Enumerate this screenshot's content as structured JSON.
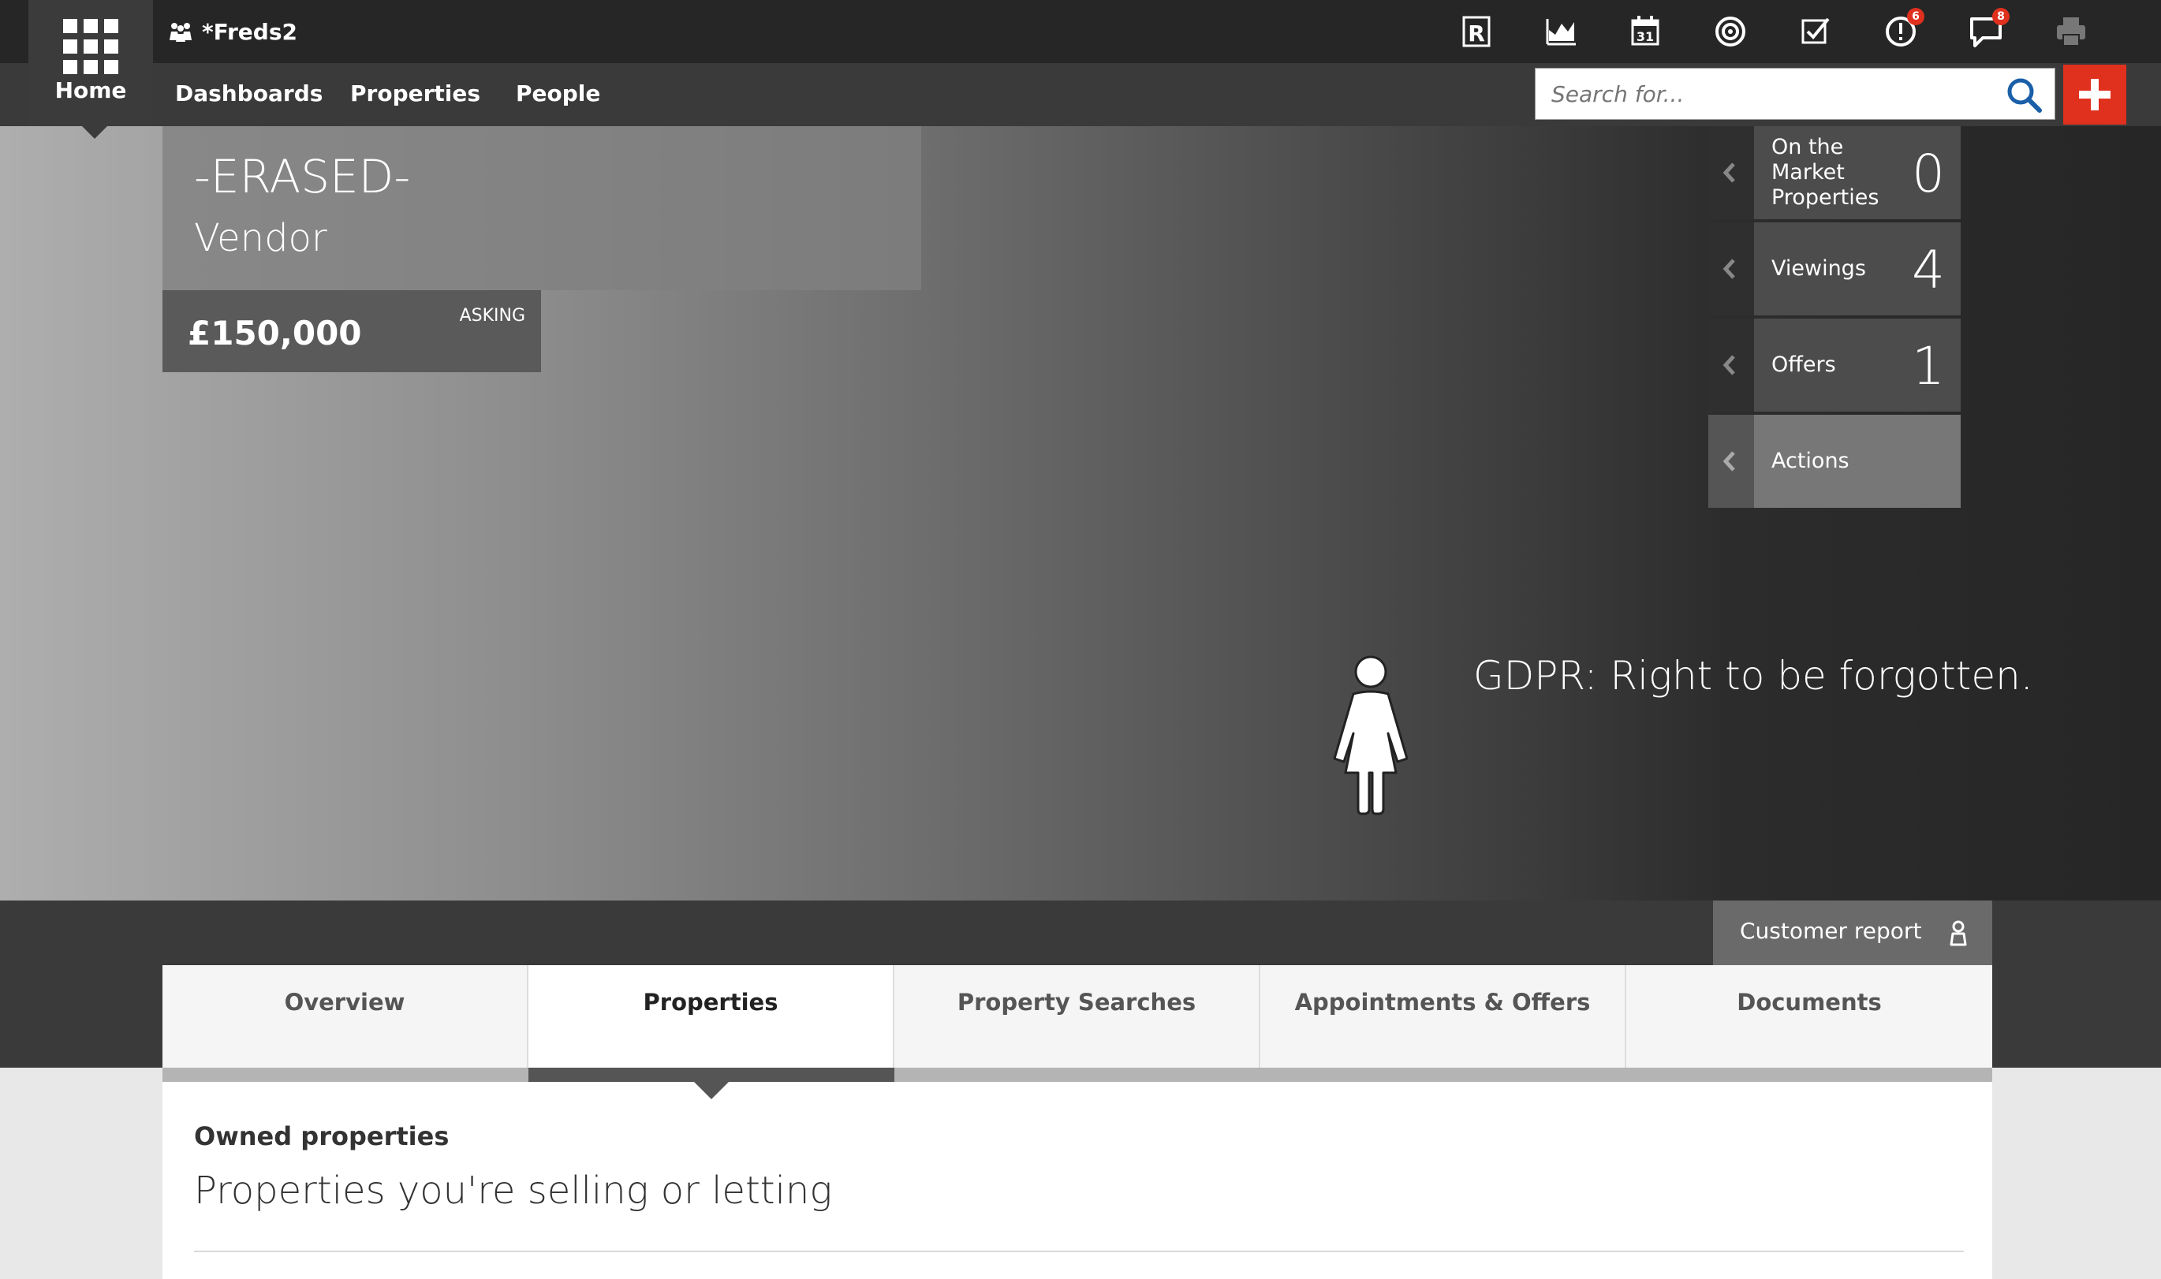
{
  "header": {
    "home_label": "Home",
    "brand_name": "*Freds2",
    "notifications": {
      "alerts_count": "6",
      "messages_count": "8"
    }
  },
  "nav": {
    "items": [
      {
        "label": "Dashboards"
      },
      {
        "label": "Properties"
      },
      {
        "label": "People"
      }
    ]
  },
  "search": {
    "placeholder": "Search for..."
  },
  "profile": {
    "name": "-ERASED-",
    "role": "Vendor",
    "price": "£150,000",
    "price_label": "ASKING"
  },
  "stats": [
    {
      "label": "On the Market Properties",
      "value": "0"
    },
    {
      "label": "Viewings",
      "value": "4"
    },
    {
      "label": "Offers",
      "value": "1"
    },
    {
      "label": "Actions",
      "value": ""
    }
  ],
  "gdpr": {
    "text": "GDPR: Right to be forgotten."
  },
  "customer_report": {
    "label": "Customer report"
  },
  "tabs": [
    {
      "label": "Overview"
    },
    {
      "label": "Properties"
    },
    {
      "label": "Property Searches"
    },
    {
      "label": "Appointments & Offers"
    },
    {
      "label": "Documents"
    }
  ],
  "content": {
    "subtitle": "Owned properties",
    "title": "Properties you're selling or letting"
  },
  "colors": {
    "accent": "#e0301e",
    "topbar": "#262626",
    "navbar": "#3a3a3a"
  }
}
